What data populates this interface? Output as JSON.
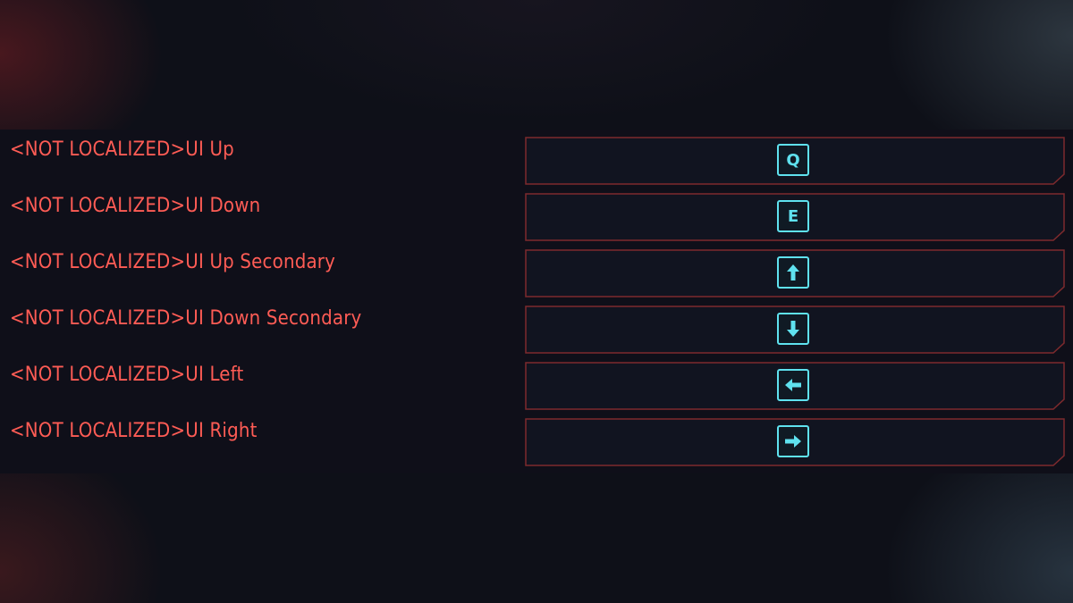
{
  "colors": {
    "label": "#ff5c55",
    "slot_border": "#7e2a2d",
    "key": "#5fe2ef"
  },
  "bindings": [
    {
      "label": "<NOT LOCALIZED>UI Up",
      "key": "Q",
      "key_type": "text"
    },
    {
      "label": "<NOT LOCALIZED>UI Down",
      "key": "E",
      "key_type": "text"
    },
    {
      "label": "<NOT LOCALIZED>UI Up Secondary",
      "key": "arrow-up-icon",
      "key_type": "icon"
    },
    {
      "label": "<NOT LOCALIZED>UI Down Secondary",
      "key": "arrow-down-icon",
      "key_type": "icon"
    },
    {
      "label": "<NOT LOCALIZED>UI Left",
      "key": "arrow-left-icon",
      "key_type": "icon"
    },
    {
      "label": "<NOT LOCALIZED>UI Right",
      "key": "arrow-right-icon",
      "key_type": "icon"
    }
  ]
}
